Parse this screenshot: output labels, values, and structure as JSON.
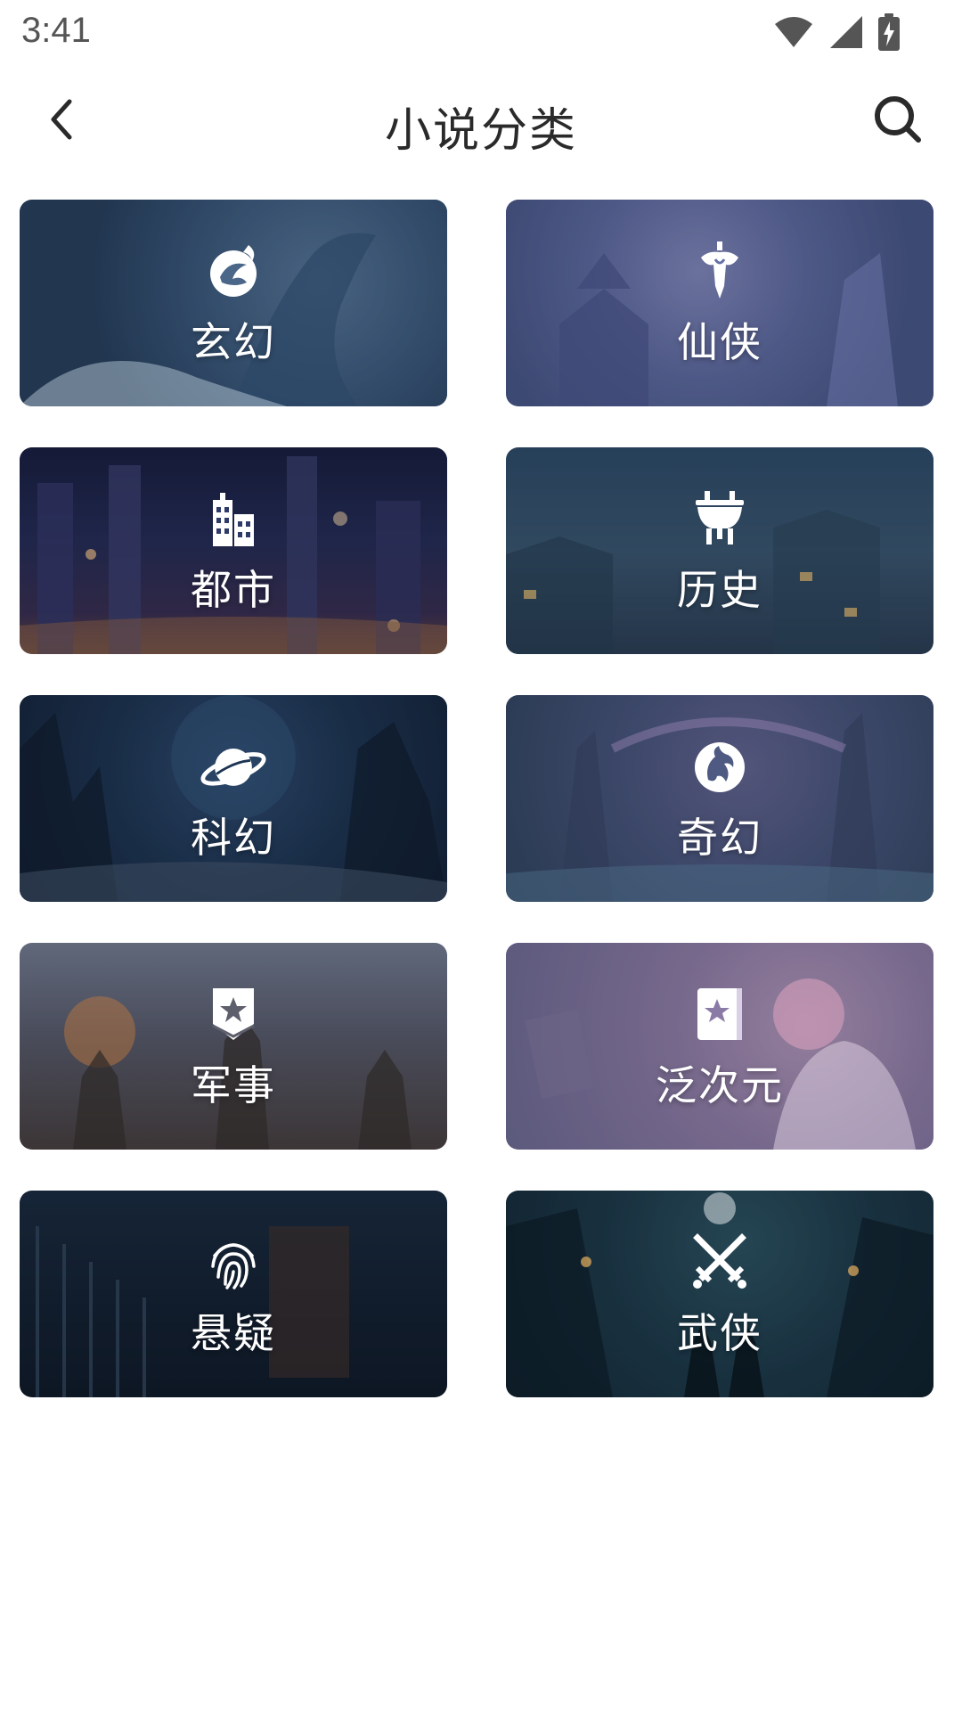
{
  "status_bar": {
    "time": "3:41",
    "icons": [
      "wifi-icon",
      "signal-icon",
      "battery-charging-icon"
    ]
  },
  "app_bar": {
    "title": "小说分类",
    "back_icon": "chevron-left-icon",
    "search_icon": "search-icon"
  },
  "categories": [
    {
      "label": "玄幻",
      "icon": "phoenix-icon"
    },
    {
      "label": "仙侠",
      "icon": "sword-icon"
    },
    {
      "label": "都市",
      "icon": "buildings-icon"
    },
    {
      "label": "历史",
      "icon": "ding-cauldron-icon"
    },
    {
      "label": "科幻",
      "icon": "planet-icon"
    },
    {
      "label": "奇幻",
      "icon": "dragon-icon"
    },
    {
      "label": "军事",
      "icon": "military-badge-icon"
    },
    {
      "label": "泛次元",
      "icon": "star-book-icon"
    },
    {
      "label": "悬疑",
      "icon": "fingerprint-icon"
    },
    {
      "label": "武侠",
      "icon": "crossed-swords-icon"
    }
  ]
}
